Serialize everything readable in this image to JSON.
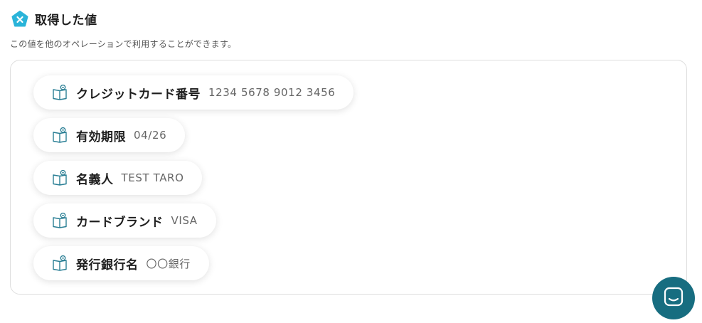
{
  "header": {
    "title": "取得した値",
    "description": "この値を他のオペレーションで利用することができます。"
  },
  "items": [
    {
      "name": "クレジットカード番号",
      "value": "1234 5678 9012 3456"
    },
    {
      "name": "有効期限",
      "value": "04/26"
    },
    {
      "name": "名義人",
      "value": "TEST TARO"
    },
    {
      "name": "カードブランド",
      "value": "VISA"
    },
    {
      "name": "発行銀行名",
      "value": "〇〇銀行"
    }
  ],
  "icons": {
    "header": "close-x-hex-icon",
    "item": "book-search-icon",
    "chat": "chat-icon"
  },
  "colors": {
    "accent": "#2ab4d9",
    "chat": "#176d80"
  }
}
